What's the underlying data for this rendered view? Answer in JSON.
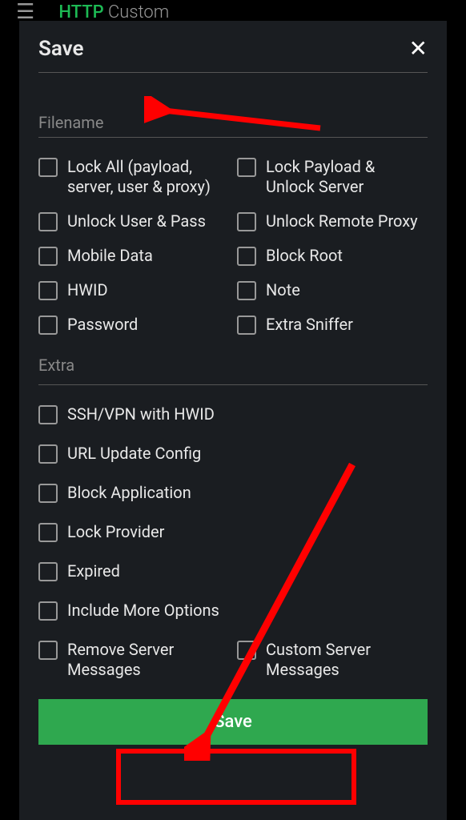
{
  "appBar": {
    "http": "HTTP",
    "custom": "Custom"
  },
  "dialog": {
    "title": "Save",
    "filenameLabel": "Filename",
    "extraSectionTitle": "Extra",
    "saveButton": "Save"
  },
  "options": {
    "main": [
      {
        "label": "Lock All (payload, server, user & proxy)"
      },
      {
        "label": "Lock Payload & Unlock Server"
      },
      {
        "label": "Unlock User & Pass"
      },
      {
        "label": "Unlock Remote Proxy"
      },
      {
        "label": "Mobile Data"
      },
      {
        "label": "Block Root"
      },
      {
        "label": "HWID"
      },
      {
        "label": "Note"
      },
      {
        "label": "Password"
      },
      {
        "label": "Extra Sniffer"
      }
    ],
    "extra": [
      {
        "label": "SSH/VPN with HWID"
      },
      {
        "label": "URL Update Config"
      },
      {
        "label": "Block Application"
      },
      {
        "label": "Lock Provider"
      },
      {
        "label": "Expired"
      },
      {
        "label": "Include More Options"
      }
    ],
    "extraRow": [
      {
        "label": "Remove Server Messages"
      },
      {
        "label": "Custom Server Messages"
      }
    ]
  }
}
